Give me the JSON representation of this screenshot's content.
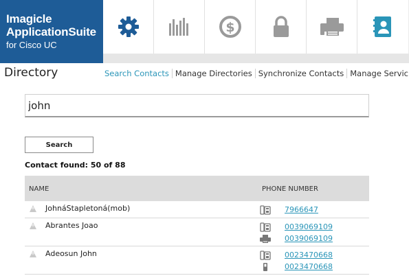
{
  "brand": {
    "line1": "Imagicle",
    "line2": "ApplicationSuite",
    "line3": "for Cisco UC"
  },
  "modules": [
    {
      "icon": "gear-icon",
      "active": true
    },
    {
      "icon": "bar-chart-icon",
      "active": false
    },
    {
      "icon": "dollar-icon",
      "active": false
    },
    {
      "icon": "lock-icon",
      "active": false
    },
    {
      "icon": "fax-icon",
      "active": false
    },
    {
      "icon": "contact-book-icon",
      "active": false
    }
  ],
  "page": {
    "title": "Directory"
  },
  "tabs": [
    {
      "label": "Search Contacts",
      "active": true
    },
    {
      "label": "Manage Directories",
      "active": false
    },
    {
      "label": "Synchronize Contacts",
      "active": false
    },
    {
      "label": "Manage Servic",
      "active": false
    }
  ],
  "search": {
    "value": "john",
    "button_label": "Search"
  },
  "results": {
    "found_text": "Contact found: 50 of 88",
    "columns": {
      "name": "NAME",
      "phone": "PHONE NUMBER"
    },
    "rows": [
      {
        "name": "JohnáStapletoná(mob)",
        "phones": [
          {
            "type": "office-phone-icon",
            "number": "7966647"
          }
        ]
      },
      {
        "name": "Abrantes Joao",
        "phones": [
          {
            "type": "office-phone-icon",
            "number": "0039069109"
          },
          {
            "type": "fax-icon",
            "number": "0039069109"
          }
        ]
      },
      {
        "name": "Adeosun John",
        "phones": [
          {
            "type": "office-phone-icon",
            "number": "0023470668"
          },
          {
            "type": "mobile-phone-icon",
            "number": "0023470668"
          }
        ]
      }
    ]
  },
  "colors": {
    "brand_blue": "#1e5c97",
    "accent": "#2a95b8",
    "header_bg": "#ececec"
  }
}
